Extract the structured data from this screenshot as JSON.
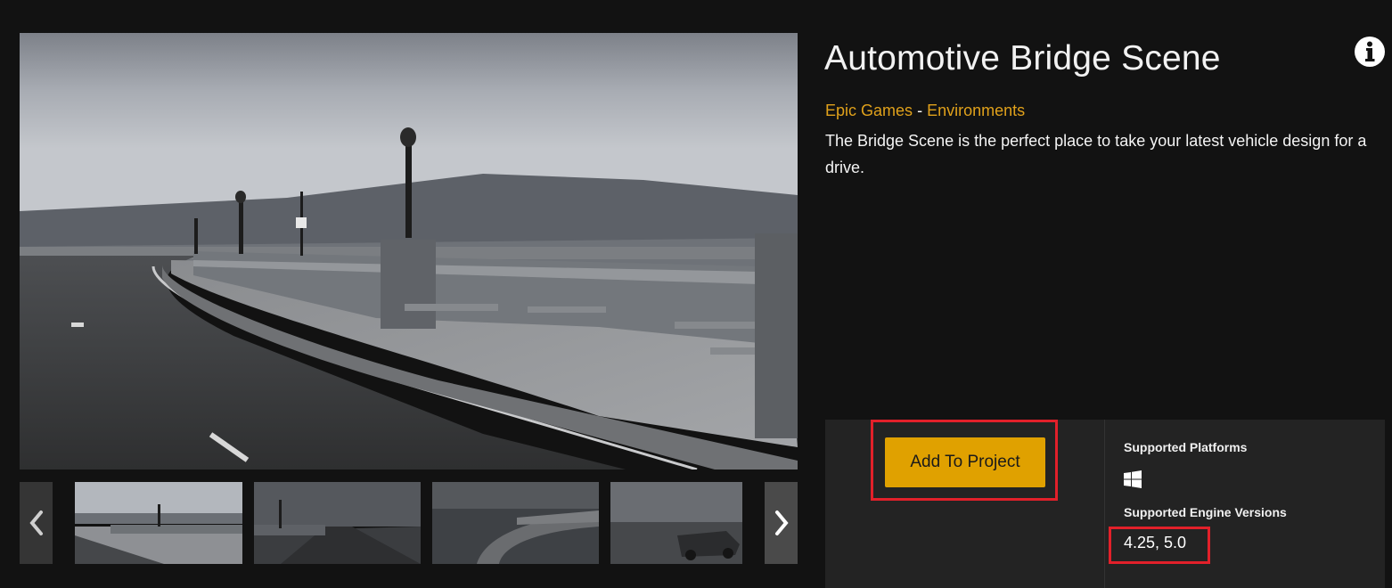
{
  "asset": {
    "title": "Automotive Bridge Scene",
    "publisher": "Epic Games",
    "category": "Environments",
    "separator": "-",
    "description": "The Bridge Scene is the perfect place to take your latest vehicle design for a drive."
  },
  "actions": {
    "add_to_project_label": "Add To Project"
  },
  "support": {
    "platforms_label": "Supported Platforms",
    "platforms": [
      "windows-icon"
    ],
    "engine_versions_label": "Supported Engine Versions",
    "engine_versions": "4.25, 5.0"
  },
  "gallery": {
    "selected_index": 0,
    "thumbnails": [
      "bridge-walkway",
      "bridge-road",
      "bridge-aerial",
      "bridge-car"
    ],
    "nav_prev_icon": "chevron-left-icon",
    "nav_next_icon": "chevron-right-icon"
  },
  "colors": {
    "accent": "#e0a100",
    "link": "#e0a11b",
    "highlight": "#e2202a",
    "background": "#121212",
    "panel": "#232323"
  }
}
